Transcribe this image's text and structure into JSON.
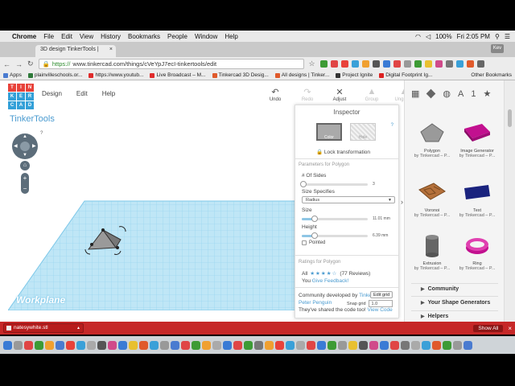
{
  "macos_menu": {
    "apple": "",
    "app": "Chrome",
    "items": [
      "File",
      "Edit",
      "View",
      "History",
      "Bookmarks",
      "People",
      "Window",
      "Help"
    ],
    "battery": "100%",
    "clock": "Fri 2:05 PM"
  },
  "browser": {
    "tab_title": "3D design TinkerTools |",
    "profile": "Kev",
    "url_scheme": "https://",
    "url_rest": "www.tinkercad.com/things/cVeYpJ7ecI-tinkertools/edit",
    "bookmarks": [
      {
        "label": "Apps",
        "color": "#4a7bd0"
      },
      {
        "label": "plainvilleschools.or...",
        "color": "#2f7a3b"
      },
      {
        "label": "https://www.youtub...",
        "color": "#e02b2b"
      },
      {
        "label": "Live Broadcast – M...",
        "color": "#e02b2b"
      },
      {
        "label": "Tinkercad 3D Desig...",
        "color": "#e05a2b"
      },
      {
        "label": "All designs | Tinker...",
        "color": "#e05a2b"
      },
      {
        "label": "Project Ignite",
        "color": "#333333"
      },
      {
        "label": "Digital Footprint Ig...",
        "color": "#d22"
      }
    ],
    "other_bookmarks": "Other Bookmarks"
  },
  "app": {
    "logo_letters": [
      "T",
      "I",
      "N",
      "K",
      "E",
      "R",
      "C",
      "A",
      "D"
    ],
    "logo_colors": [
      "#e8423a",
      "#e8423a",
      "#e8423a",
      "#33a0d8",
      "#33a0d8",
      "#33a0d8",
      "#33a0d8",
      "#33a0d8",
      "#33a0d8"
    ],
    "menu": [
      "Design",
      "Edit",
      "Help"
    ],
    "toolbar": [
      {
        "label": "Undo",
        "glyph": "↶",
        "enabled": true
      },
      {
        "label": "Redo",
        "glyph": "↷",
        "enabled": false
      },
      {
        "label": "Adjust",
        "glyph": "✕",
        "enabled": true
      },
      {
        "label": "Group",
        "glyph": "▲",
        "enabled": false
      },
      {
        "label": "Ungroup",
        "glyph": "▲",
        "enabled": false
      }
    ],
    "design_title": "TinkerTools",
    "help_q": "?",
    "home_icon": "⌂",
    "zoom_plus": "+",
    "zoom_minus": "−",
    "workplane_label": "Workplane"
  },
  "inspector": {
    "title": "Inspector",
    "help": "?",
    "color_label": "Color",
    "hole_label": "Hole",
    "lock_label": "Lock transformation",
    "params_title": "Parameters for Polygon",
    "sides_label": "# Of Sides",
    "sides_value": "3",
    "size_spec_label": "Size Specifies",
    "size_spec_value": "Radius",
    "size_label": "Size",
    "size_value": "11.01 mm",
    "height_label": "Height",
    "height_value": "6.39 mm",
    "pointed_label": "Pointed",
    "ratings_title": "Ratings for Polygon",
    "ratings_all": "All",
    "stars": "★★★★☆",
    "reviews": "(77 Reviews)",
    "you_label": "You",
    "feedback_link": "Give Feedback!",
    "community_text": "Community developed by",
    "community_author": "Tinkercad",
    "community_author2": "Peter Penguin",
    "shared_text": "They've shared the code too!",
    "shared_link": "View Code",
    "edit_grid": "Edit grid",
    "snap_grid_label": "Snap grid",
    "snap_grid_value": "1.0"
  },
  "shapes_panel": {
    "shapes": [
      {
        "name": "Polygon",
        "by": "by Tinkercad – P..."
      },
      {
        "name": "Image Generator",
        "by": "by Tinkercad – P..."
      },
      {
        "name": "Voronoi",
        "by": "by Tinkercad – P..."
      },
      {
        "name": "Text",
        "by": "by Tinkercad – P..."
      },
      {
        "name": "Extrusion",
        "by": "by Tinkercad – P..."
      },
      {
        "name": "Ring",
        "by": "by Tinkercad – P..."
      }
    ],
    "sections": [
      "Community",
      "Your Shape Generators",
      "Helpers"
    ],
    "top_glyphs": {
      "a": "A",
      "one": "1",
      "star": "★"
    }
  },
  "download_bar": {
    "file": "natesywhite.stl",
    "show_all": "Show All",
    "close": "×"
  },
  "dock_colors": [
    "#3a7bd5",
    "#999",
    "#e04545",
    "#3d9b35",
    "#f0a030",
    "#4a7bd0",
    "#e8423a",
    "#3aa0d8",
    "#aaa",
    "#555",
    "#d04a8a",
    "#3a7bd5",
    "#e8c030",
    "#e05a2b",
    "#3aa0d8",
    "#999",
    "#4a7bd0",
    "#e04545",
    "#3d9b35",
    "#f0a030",
    "#aaa",
    "#3a7bd5",
    "#e04545",
    "#3d9b35",
    "#777",
    "#f0a030",
    "#e8423a",
    "#3aa0d8",
    "#aaa",
    "#e04545",
    "#3a7bd5",
    "#3d9b35",
    "#999",
    "#e8c030",
    "#555",
    "#d04a8a",
    "#3a7bd5",
    "#e04545",
    "#777",
    "#aaa",
    "#3aa0d8",
    "#e05a2b",
    "#3d9b35",
    "#999",
    "#4a7bd0"
  ]
}
